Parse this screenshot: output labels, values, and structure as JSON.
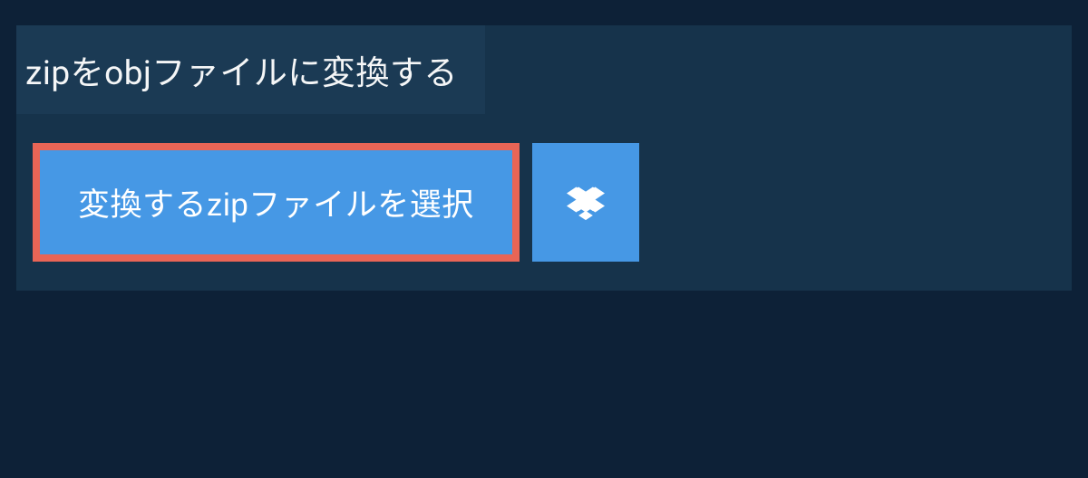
{
  "title": "zipをobjファイルに変換する",
  "buttons": {
    "select_file": "変換するzipファイルを選択"
  }
}
